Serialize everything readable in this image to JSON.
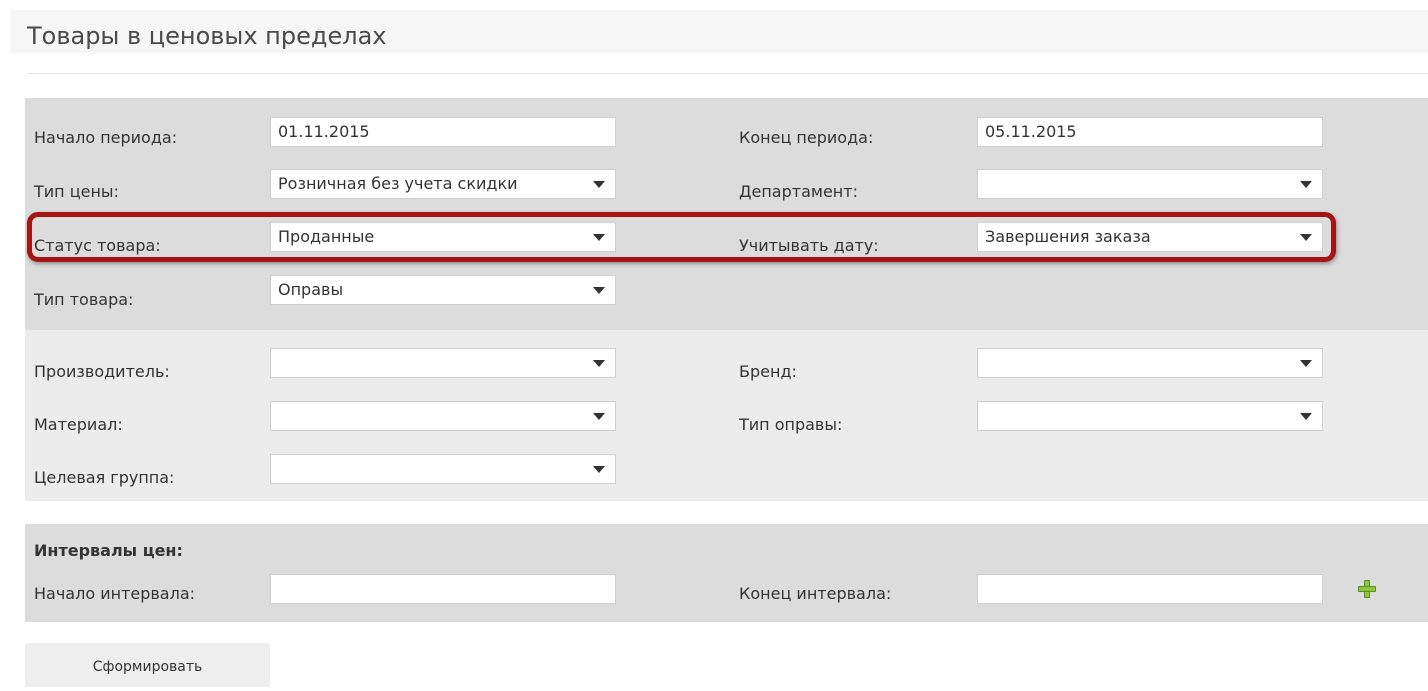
{
  "page": {
    "title": "Товары в ценовых пределах"
  },
  "filters": {
    "period_start": {
      "label": "Начало периода:",
      "value": "01.11.2015"
    },
    "period_end": {
      "label": "Конец периода:",
      "value": "05.11.2015"
    },
    "price_type": {
      "label": "Тип цены:",
      "value": "Розничная без учета скидки"
    },
    "department": {
      "label": "Департамент:",
      "value": ""
    },
    "product_status": {
      "label": "Статус товара:",
      "value": "Проданные"
    },
    "date_basis": {
      "label": "Учитывать дату:",
      "value": "Завершения заказа"
    },
    "product_type": {
      "label": "Тип товара:",
      "value": "Оправы"
    }
  },
  "attributes": {
    "manufacturer": {
      "label": "Производитель:",
      "value": ""
    },
    "brand": {
      "label": "Бренд:",
      "value": ""
    },
    "material": {
      "label": "Материал:",
      "value": ""
    },
    "frame_type": {
      "label": "Тип оправы:",
      "value": ""
    },
    "target_group": {
      "label": "Целевая группа:",
      "value": ""
    }
  },
  "intervals": {
    "heading": "Интервалы цен:",
    "start": {
      "label": "Начало интервала:",
      "value": ""
    },
    "end": {
      "label": "Конец интервала:",
      "value": ""
    },
    "add_icon": "plus-icon"
  },
  "actions": {
    "submit_label": "Сформировать"
  },
  "colors": {
    "highlight": "#a41414",
    "panel_dark": "#dcdcdc",
    "panel_light": "#ececec",
    "add_icon": "#8cc63f"
  }
}
